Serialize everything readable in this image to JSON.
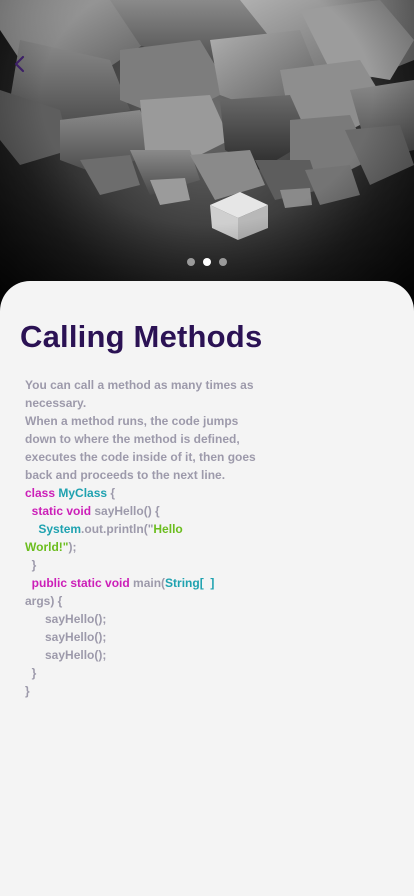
{
  "header": {
    "back_icon": "chevron-left-icon",
    "carousel": {
      "count": 3,
      "active_index": 1
    }
  },
  "lesson": {
    "title": "Calling Methods",
    "paragraphs": [
      "You can call a method as many times as necessary.",
      "When a method runs, the code jumps down to where the method is defined, executes the code inside of it, then goes back and proceeds to the next line."
    ]
  },
  "code": {
    "line1": {
      "kw": "class",
      "cls": "MyClass",
      "rest": " {"
    },
    "line2": {
      "indent": "  ",
      "kw": "static void",
      "rest": " sayHello() {"
    },
    "line3": {
      "indent": "    ",
      "cls": "System",
      "rest": ".out.println(\"",
      "str": "Hello"
    },
    "line4": {
      "str": "World!\"",
      "rest": ");"
    },
    "line5": {
      "text": "  }"
    },
    "line6": {
      "indent": "  ",
      "kw": "public static void",
      "rest": " main(",
      "cls": "String[  ]"
    },
    "line7": {
      "text": "args) {"
    },
    "line8": {
      "text": "      sayHello();"
    },
    "line9": {
      "text": "      sayHello();"
    },
    "line10": {
      "text": "      sayHello();"
    },
    "line11": {
      "text": "  }"
    },
    "line12": {
      "text": "}"
    }
  },
  "colors": {
    "title": "#2b1254",
    "body": "#9d9aab",
    "keyword": "#cc1fb8",
    "class_name": "#1fa2b0",
    "string": "#6bbd1e",
    "back_icon": "#3c1f66"
  }
}
